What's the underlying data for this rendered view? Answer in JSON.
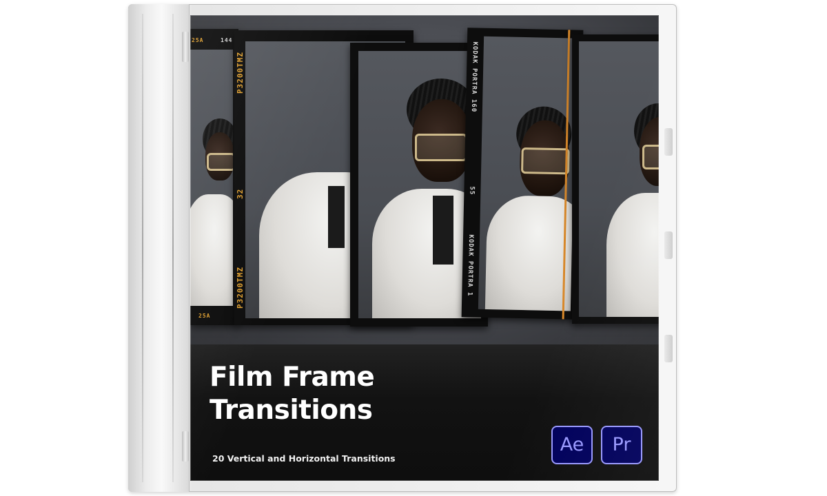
{
  "product": {
    "title_line1": "Film Frame",
    "title_line2": "Transitions",
    "subtitle": "20 Vertical and Horizontal Transitions"
  },
  "apps": [
    {
      "label": "Ae",
      "icon": "after-effects-icon",
      "color": "#9999ff",
      "background": "#00005b"
    },
    {
      "label": "Pr",
      "icon": "premiere-pro-icon",
      "color": "#9999ff",
      "background": "#00005b"
    }
  ],
  "film_markings": {
    "frame_top": "25A",
    "frame_top_right": "144",
    "stock_a": "P3200TMZ",
    "frame_number": "32",
    "stock_b": "P3200TMZ",
    "frame_bottom": "25A",
    "kodak_top": "KODAK PORTRA 160",
    "kodak_number": "55",
    "kodak_bottom": "KODAK PORTRA 1"
  },
  "colors": {
    "accent_orange": "#e0a030",
    "cover_dark": "#151515"
  }
}
